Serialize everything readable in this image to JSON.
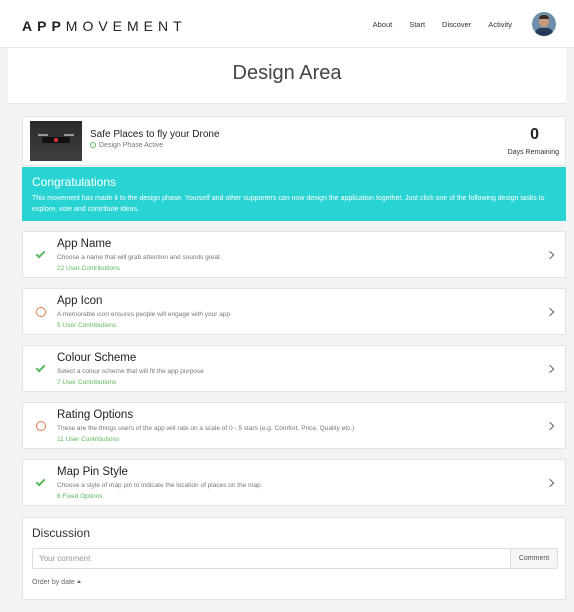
{
  "header": {
    "logo_bold": "APP",
    "logo_rest": "MOVEMENT",
    "nav": [
      "About",
      "Start",
      "Discover",
      "Activity"
    ]
  },
  "page": {
    "title": "Design Area"
  },
  "movement": {
    "title": "Safe Places to fly your Drone",
    "status": "Design Phase Active",
    "days_remaining": "0",
    "days_label": "Days Remaining"
  },
  "congrats": {
    "title": "Congratulations",
    "body": "This movement has made it to the design phase. Yourself and other supporters can now design the application together. Just click one of the following design tasks to explore, vote and contribute ideas."
  },
  "tasks": [
    {
      "title": "App Name",
      "desc": "Choose a name that will grab attention and sounds great",
      "count": "22 User Contributions",
      "status": "complete"
    },
    {
      "title": "App Icon",
      "desc": "A memorable icon ensures people will engage with your app",
      "count": "5 User Contributions",
      "status": "open"
    },
    {
      "title": "Colour Scheme",
      "desc": "Select a colour scheme that will fit the app purpose",
      "count": "7 User Contributions",
      "status": "complete"
    },
    {
      "title": "Rating Options",
      "desc": "These are the things users of the app will rate on a scale of 0 - 5 stars (e.g. Comfort, Price, Quality etc.)",
      "count": "11 User Contributions",
      "status": "open"
    },
    {
      "title": "Map Pin Style",
      "desc": "Choose a style of map pin to indicate the location of places on the map",
      "count": "6 Fixed Options",
      "status": "complete"
    }
  ],
  "discussion": {
    "title": "Discussion",
    "placeholder": "Your comment",
    "button": "Comment",
    "order": "Order by date"
  },
  "colors": {
    "accent": "#28d3d3",
    "complete": "#5cb85c",
    "open": "#f0744a"
  }
}
